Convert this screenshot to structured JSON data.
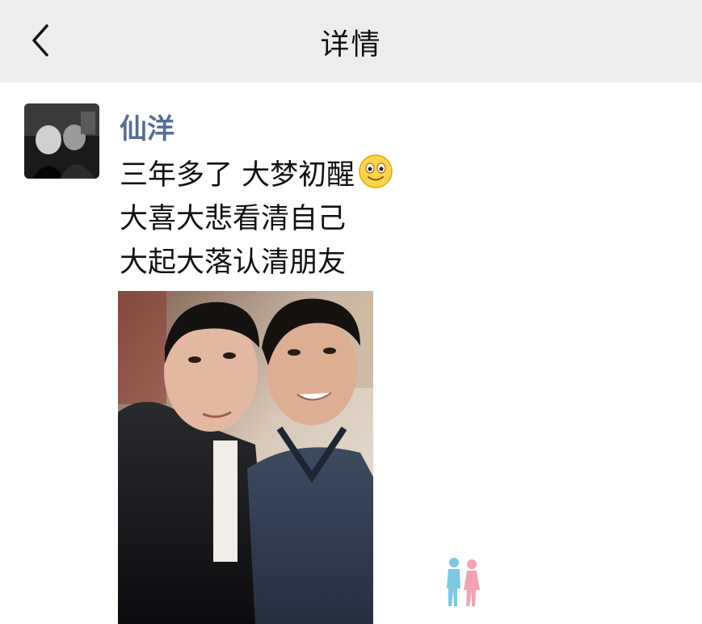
{
  "header": {
    "back_icon": "chevron-left-icon",
    "title": "详情",
    "background": "#ededed"
  },
  "post": {
    "author": {
      "name": "仙洋",
      "name_color": "#576b95"
    },
    "text_lines": [
      "三年多了 大梦初醒",
      "大喜大悲看清自己",
      "大起大落认清朋友"
    ],
    "emoji": "smile-emoji",
    "photo_icon": "photo-image",
    "watermark_icon": "couple-silhouette-logo"
  }
}
